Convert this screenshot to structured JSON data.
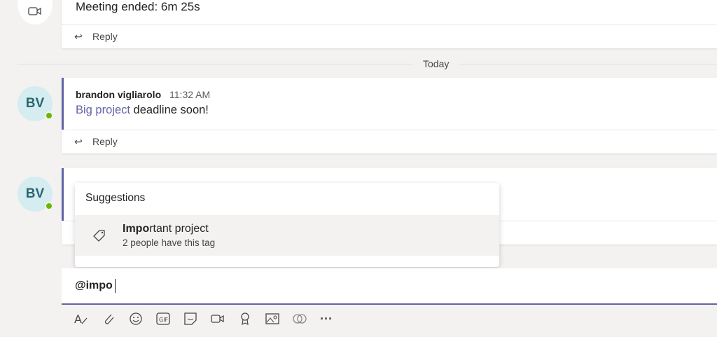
{
  "meeting": {
    "text": "Meeting ended: 6m 25s",
    "reply": "Reply"
  },
  "divider": "Today",
  "messages": [
    {
      "initials": "BV",
      "author": "brandon vigliarolo",
      "time": "11:32 AM",
      "tag": "Big project",
      "text": " deadline soon!",
      "reply": "Reply"
    },
    {
      "initials": "BV"
    }
  ],
  "suggestions": {
    "title": "Suggestions",
    "items": [
      {
        "bold": "Impo",
        "rest": "rtant project",
        "sub": "2 people have this tag"
      }
    ]
  },
  "compose": {
    "value": "@impo"
  },
  "toolbar": [
    "format-icon",
    "attach-icon",
    "emoji-icon",
    "gif-icon",
    "sticker-icon",
    "meet-now-icon",
    "praise-icon",
    "image-icon",
    "loop-icon",
    "more-icon"
  ],
  "colors": {
    "accent": "#6264a7",
    "presence": "#6bb700"
  }
}
